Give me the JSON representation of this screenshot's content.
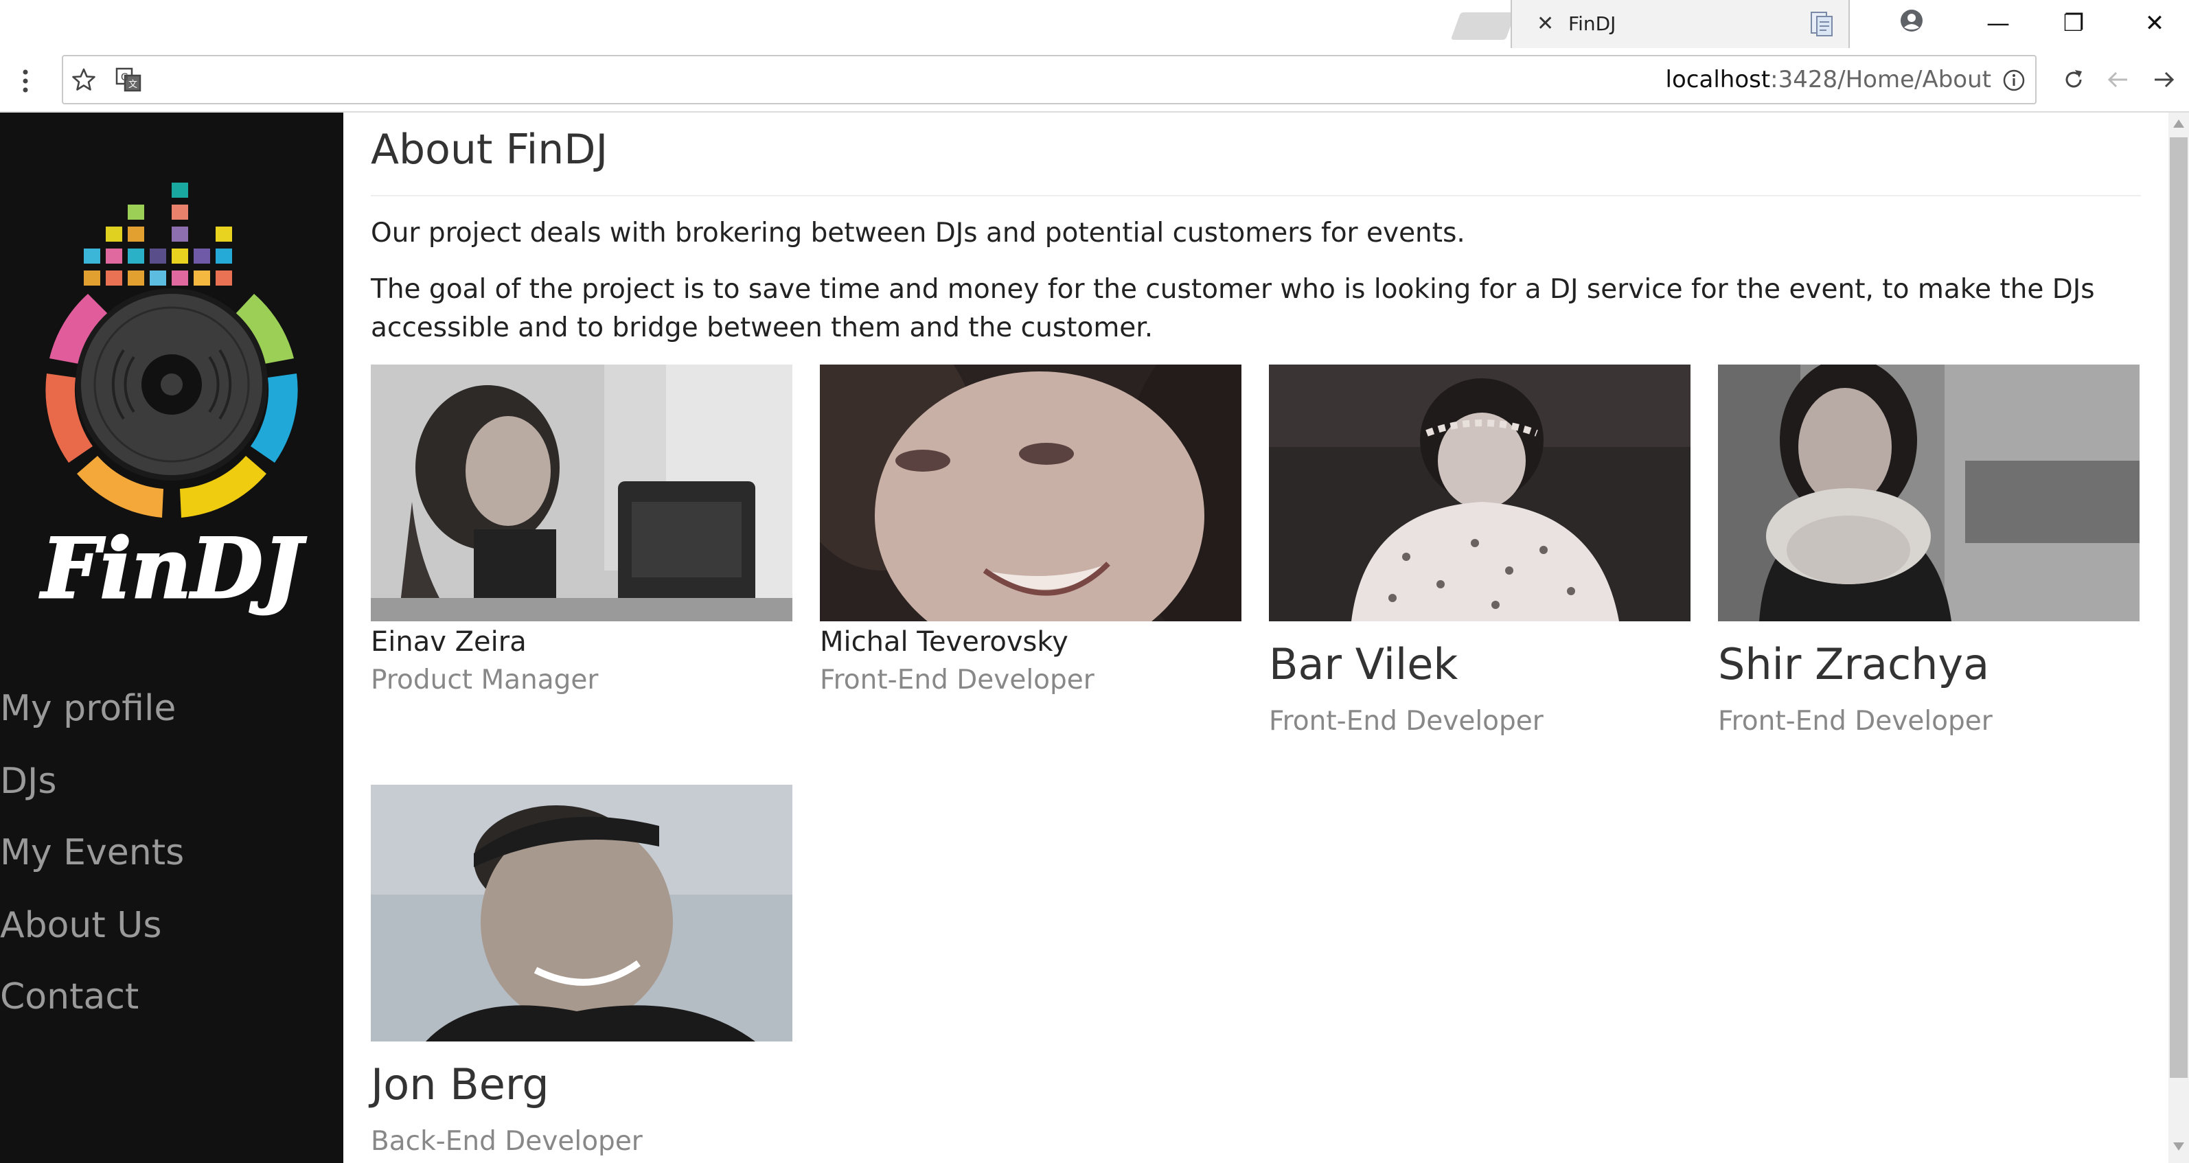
{
  "browser": {
    "tab_title": "FinDJ",
    "tab_close": "✕",
    "url_host": "localhost",
    "url_rest": ":3428/Home/About",
    "window_controls": {
      "minimize": "—",
      "maximize": "❐",
      "close": "✕"
    },
    "icons": [
      "star-icon",
      "translate-icon",
      "info-icon",
      "reload-icon",
      "back-icon",
      "forward-icon",
      "account-icon",
      "menu-dots-icon",
      "doc-icon"
    ]
  },
  "sidebar": {
    "logo_text": "FinDJ",
    "items": [
      {
        "label": "My profile"
      },
      {
        "label": "DJs"
      },
      {
        "label": "My Events"
      },
      {
        "label": "About Us"
      },
      {
        "label": "Contact"
      }
    ]
  },
  "main": {
    "title": "About FinDJ",
    "intro_1": "Our project deals with brokering between DJs and potential customers for events.",
    "intro_2": "The goal of the project is to save time and money for the customer who is looking for a DJ service for the event, to make the DJs accessible and to bridge between them and the customer.",
    "team": [
      {
        "name": "Einav Zeira",
        "role": "Product Manager"
      },
      {
        "name": "Michal Teverovsky",
        "role": "Front-End Developer"
      },
      {
        "name": "Bar Vilek",
        "role": "Front-End Developer"
      },
      {
        "name": "Shir Zrachya",
        "role": "Front-End Developer"
      },
      {
        "name": "Jon Berg",
        "role": "Back-End Developer"
      }
    ]
  },
  "colors": {
    "sidebar_bg": "#111111",
    "nav_text": "#9a9a9a",
    "role_text": "#888888",
    "heading_text": "#333333"
  }
}
